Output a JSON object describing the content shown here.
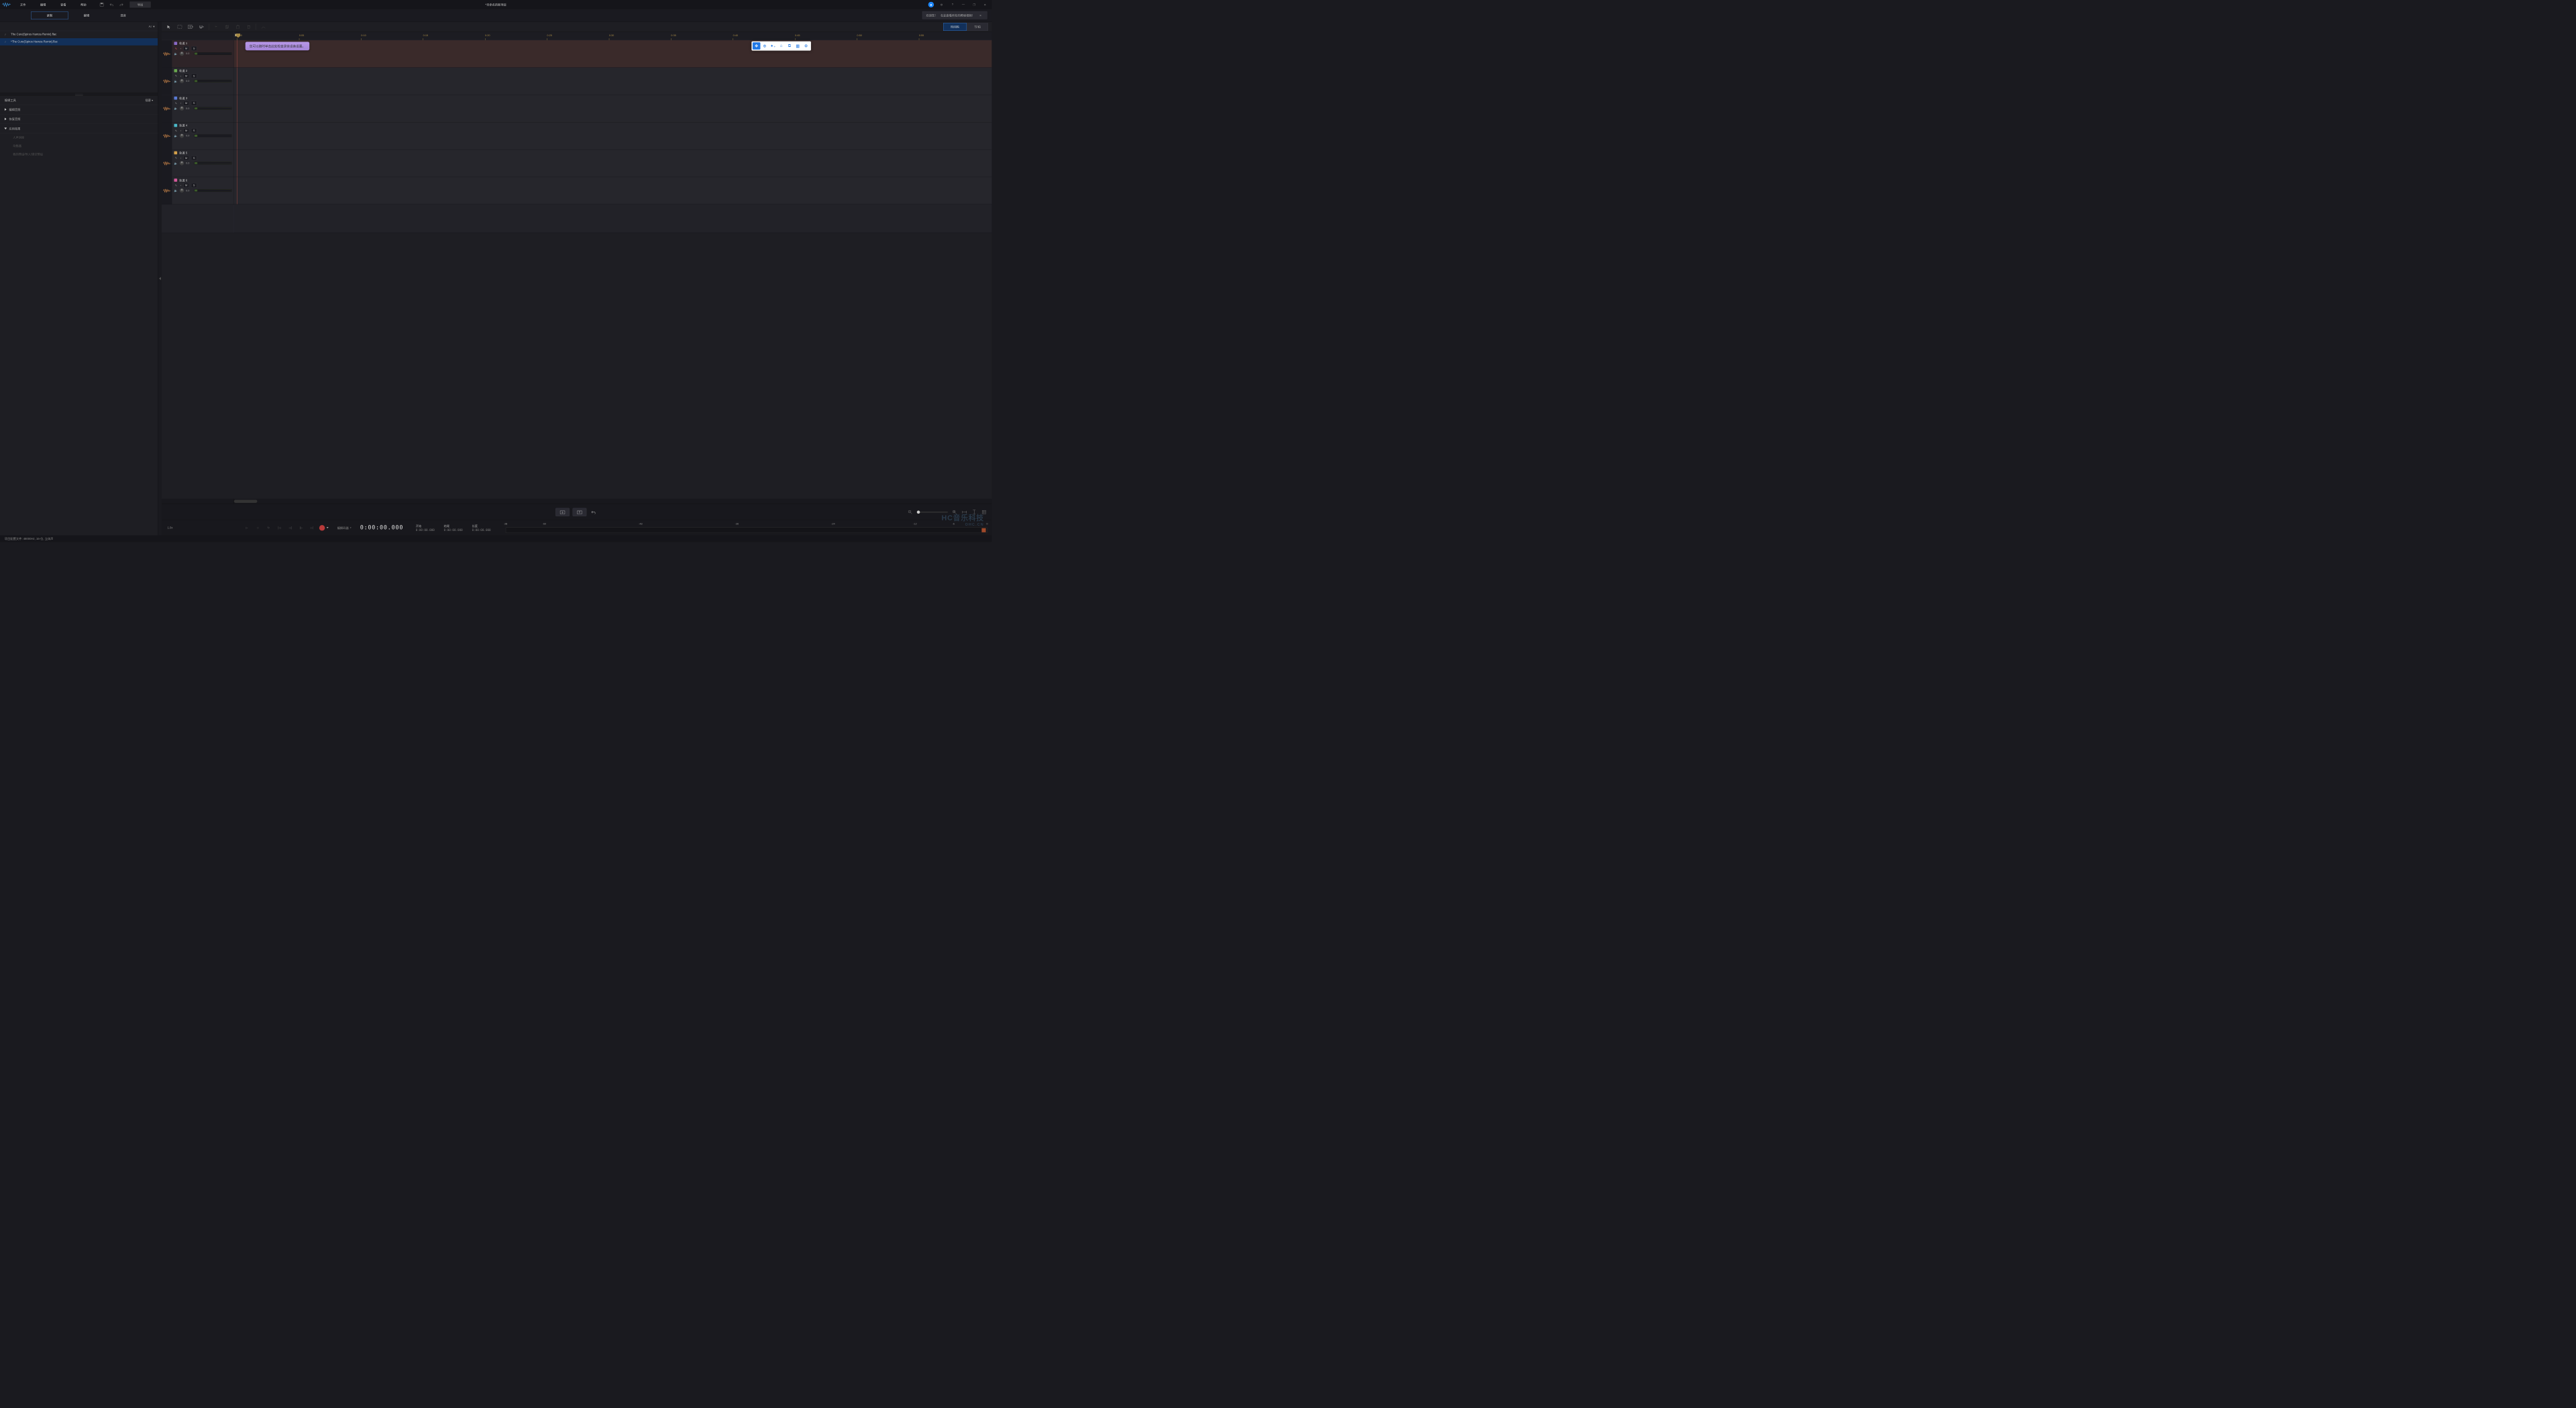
{
  "app": {
    "title": "*未命名的新项目",
    "menu": [
      "文件",
      "编辑",
      "查看",
      "帮助"
    ],
    "export": "导出"
  },
  "titlebar_icons": {
    "account": "●",
    "settings": "⚙",
    "help": "?",
    "minimize": "—",
    "maximize": "❐",
    "close": "✕"
  },
  "modes": {
    "record": "录制",
    "edit": "编辑",
    "mix": "混音",
    "active": "record"
  },
  "welcome": {
    "prefix": "欢迎您！",
    "text": "在此查看所有的教程视频！"
  },
  "sidebar": {
    "sort": "A↑ ▾",
    "files": [
      {
        "name": "The Cure(Spiros Hamza Remix).flac",
        "active": false
      },
      {
        "name": "*The Cure(Spiros Hamza Remix).flac",
        "active": true
      }
    ],
    "tools_title": "编辑工具",
    "plugins": "插客 ▾",
    "sections": [
      {
        "label": "编辑音频",
        "expanded": false
      },
      {
        "label": "恢复音频",
        "expanded": false
      },
      {
        "label": "应用效果",
        "expanded": true,
        "subs": [
          "人声消除",
          "均衡器",
          "我的预设/导入/清空预设"
        ]
      }
    ]
  },
  "toolbar": {
    "time_tabs": {
      "timecode": "时间码",
      "beats": "节/拍",
      "active": "timecode"
    }
  },
  "ruler": {
    "ticks": [
      "0:00",
      "0:05",
      "0:10",
      "0:15",
      "0:20",
      "0:25",
      "0:30",
      "0:35",
      "0:40",
      "0:45",
      "0:50",
      "0:55"
    ]
  },
  "hint": "您可以随时单击此处检查录音设备设置。",
  "tracks": [
    {
      "name": "轨道 1",
      "color": "#8a6ac8",
      "db": "0.0",
      "armed": true
    },
    {
      "name": "轨道 2",
      "color": "#6aa84f",
      "db": "0.0"
    },
    {
      "name": "轨道 3",
      "color": "#5a7ad4",
      "db": "0.0"
    },
    {
      "name": "轨道 4",
      "color": "#4ab8c8",
      "db": "0.0"
    },
    {
      "name": "轨道 5",
      "color": "#d4a04a",
      "db": "0.0"
    },
    {
      "name": "轨道 6",
      "color": "#d45a9a",
      "db": "0.0"
    }
  ],
  "track_btns": {
    "mute": "M",
    "solo": "S"
  },
  "transport": {
    "speed": "1.0x",
    "decoder": "编解码器",
    "timecode": "0:00:00.000",
    "start_label": "开始",
    "end_label": "结尾",
    "length_label": "长度",
    "start": "0:00:00.000",
    "end": "0:00:00.000",
    "length": "0:00:00.000"
  },
  "db_ticks": [
    "dB",
    "-60",
    "-48",
    "-36",
    "-24",
    "-12",
    "-6",
    "0"
  ],
  "watermark": {
    "line1": "HC音乐科技",
    "line2": "OHC.CN"
  },
  "status": "项目配置文件: 48000Hz, 16-位, 立体声"
}
